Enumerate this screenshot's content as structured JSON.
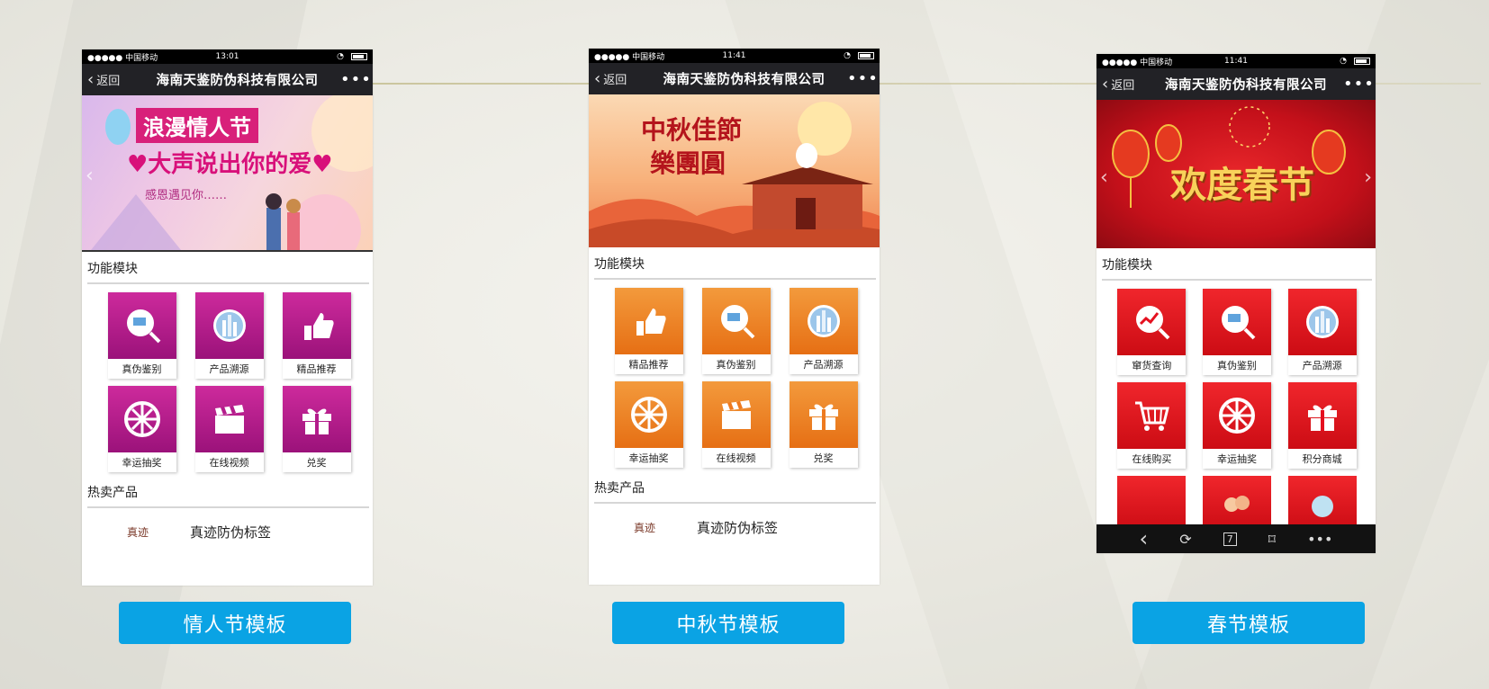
{
  "colors": {
    "accent_button": "#0aa3e4",
    "valentine_tile": "#b41c8c",
    "midautumn_tile": "#ee7a1f",
    "spring_tile": "#e5101f"
  },
  "templates": [
    {
      "status": {
        "carrier": "●●●●● 中国移动",
        "time": "13:01"
      },
      "nav": {
        "back": "返回",
        "title": "海南天鉴防伪科技有限公司",
        "more": "•••"
      },
      "banner": {
        "line1": "浪漫情人节",
        "line2": "♥大声说出你的爱♥",
        "line3": "感恩遇见你……"
      },
      "section_functions": "功能模块",
      "tiles": [
        {
          "label": "真伪鉴别",
          "icon": "magnifier-icon"
        },
        {
          "label": "产品溯源",
          "icon": "city-icon"
        },
        {
          "label": "精品推荐",
          "icon": "thumbs-up-icon"
        },
        {
          "label": "幸运抽奖",
          "icon": "lottery-wheel-icon"
        },
        {
          "label": "在线视频",
          "icon": "clapperboard-icon"
        },
        {
          "label": "兑奖",
          "icon": "gift-icon"
        }
      ],
      "section_products": "热卖产品",
      "product": {
        "logo": "真迹",
        "name": "真迹防伪标签"
      },
      "caption": "情人节模板"
    },
    {
      "status": {
        "carrier": "●●●●● 中国移动",
        "time": "11:41"
      },
      "nav": {
        "back": "返回",
        "title": "海南天鉴防伪科技有限公司",
        "more": "•••"
      },
      "banner": {
        "line1": "中秋佳節",
        "line2": "樂團圓"
      },
      "section_functions": "功能模块",
      "tiles": [
        {
          "label": "精品推荐",
          "icon": "thumbs-up-icon"
        },
        {
          "label": "真伪鉴别",
          "icon": "magnifier-icon"
        },
        {
          "label": "产品溯源",
          "icon": "city-icon"
        },
        {
          "label": "幸运抽奖",
          "icon": "lottery-wheel-icon"
        },
        {
          "label": "在线视频",
          "icon": "clapperboard-icon"
        },
        {
          "label": "兑奖",
          "icon": "gift-icon"
        }
      ],
      "section_products": "热卖产品",
      "product": {
        "logo": "真迹",
        "name": "真迹防伪标签"
      },
      "caption": "中秋节模板"
    },
    {
      "status": {
        "carrier": "●●●●● 中国移动",
        "time": "11:41"
      },
      "nav": {
        "back": "返回",
        "title": "海南天鉴防伪科技有限公司",
        "more": "•••"
      },
      "banner": {
        "line1": "欢度春节"
      },
      "section_functions": "功能模块",
      "tiles": [
        {
          "label": "窜货查询",
          "icon": "chart-search-icon"
        },
        {
          "label": "真伪鉴别",
          "icon": "magnifier-icon"
        },
        {
          "label": "产品溯源",
          "icon": "city-icon"
        },
        {
          "label": "在线购买",
          "icon": "shopping-cart-icon"
        },
        {
          "label": "幸运抽奖",
          "icon": "lottery-wheel-icon"
        },
        {
          "label": "积分商城",
          "icon": "gift-icon"
        }
      ],
      "caption": "春节模板",
      "browser_bar": {
        "back": "‹",
        "refresh": "⟳",
        "tabs": "7",
        "bookmark": "⌑",
        "more": "•••"
      }
    }
  ]
}
